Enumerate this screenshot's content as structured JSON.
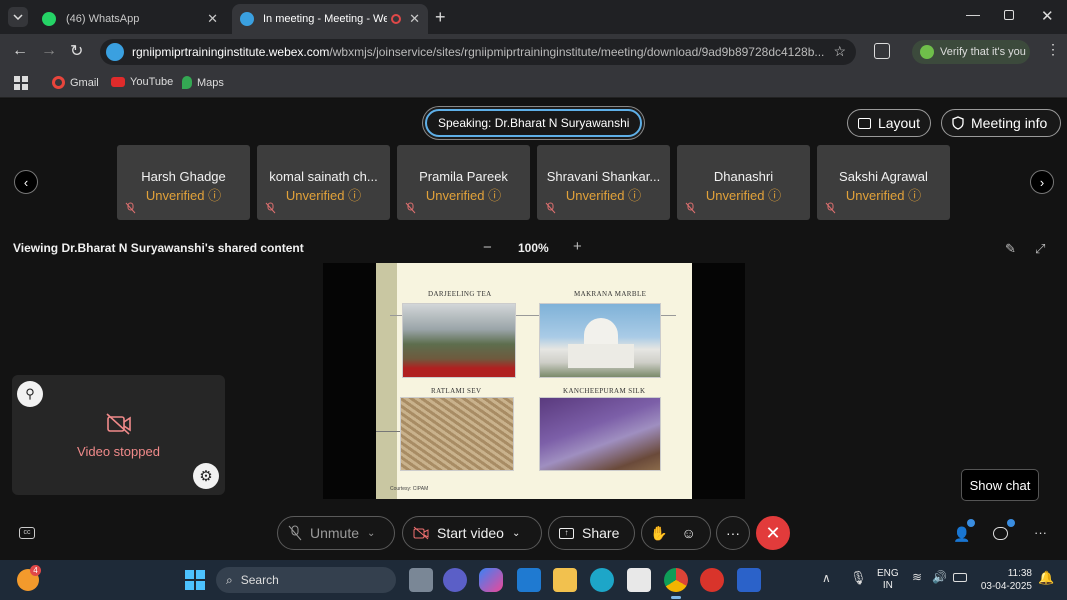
{
  "browser": {
    "tabs": [
      {
        "label": "(46) WhatsApp",
        "active": false
      },
      {
        "label": "In meeting - Meeting - Web",
        "active": true
      }
    ],
    "url_host": "rgniipmiprtraininginstitute.webex.com",
    "url_path": "/wbxmjs/joinservice/sites/rgniipmiprtraininginstitute/meeting/download/9ad9b89728dc4128b...",
    "verify_label": "Verify that it's you",
    "bookmarks": [
      "Gmail",
      "YouTube",
      "Maps"
    ]
  },
  "meeting": {
    "speaking": "Speaking: Dr.Bharat N Suryawanshi",
    "layout_label": "Layout",
    "meeting_info_label": "Meeting info",
    "participants": [
      {
        "name": "Harsh Ghadge",
        "status": "Unverified"
      },
      {
        "name": "komal sainath ch...",
        "status": "Unverified"
      },
      {
        "name": "Pramila Pareek",
        "status": "Unverified"
      },
      {
        "name": "Shravani Shankar...",
        "status": "Unverified"
      },
      {
        "name": "Dhanashri",
        "status": "Unverified"
      },
      {
        "name": "Sakshi Agrawal",
        "status": "Unverified"
      }
    ],
    "viewing_label": "Viewing Dr.Bharat N Suryawanshi's shared content",
    "zoom_minus": "−",
    "zoom_level": "100%",
    "zoom_plus": "+",
    "self_view_status": "Video stopped",
    "tooltip": "Show chat",
    "controls": {
      "unmute": "Unmute",
      "start_video": "Start video",
      "share": "Share",
      "more": "···"
    },
    "colors": {
      "end_call": "#e23b3b",
      "unverified": "#e2a23a",
      "video_stopped": "#f08a8a",
      "speaking_border": "#5fb0e8"
    }
  },
  "slide": {
    "items": [
      {
        "caption": "DARJEELING TEA"
      },
      {
        "caption": "MAKRANA MARBLE"
      },
      {
        "caption": "RATLAMI SEV"
      },
      {
        "caption": "KANCHEEPURAM SILK"
      }
    ],
    "credit": "Courtesy: CIPAM"
  },
  "taskbar": {
    "search_label": "Search",
    "lang_line1": "ENG",
    "lang_line2": "IN",
    "time": "11:38",
    "date": "03-04-2025",
    "notification_badge": "4"
  }
}
